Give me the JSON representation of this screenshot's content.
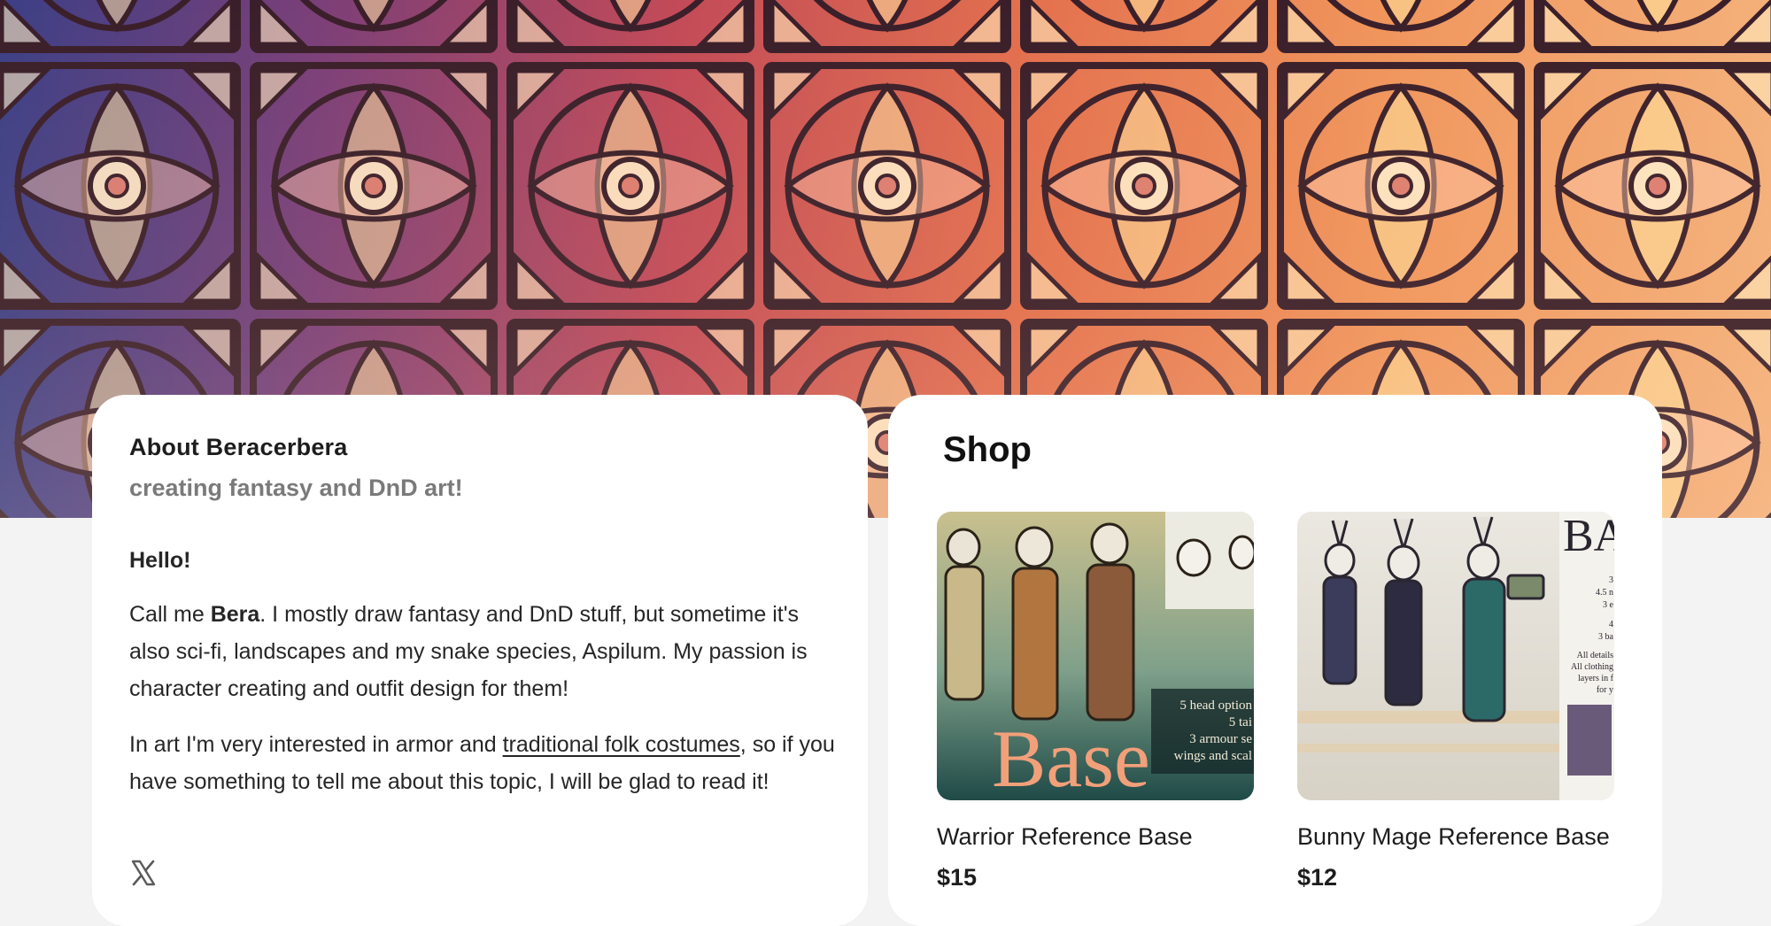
{
  "about": {
    "title": "About Beracerbera",
    "tagline": "creating fantasy and DnD art!",
    "greeting": "Hello!",
    "p1_before": "Call me ",
    "p1_name": "Bera",
    "p1_after": ". I mostly draw  fantasy and DnD stuff, but sometime it's also sci-fi, landscapes and my snake species, Aspilum. My passion is character creating and outfit design for them!",
    "p2_before": "In art I'm very interested in armor and ",
    "p2_link": "traditional folk costumes",
    "p2_after": ", so if you have something to tell me about this topic, I will be glad to read it!",
    "social_icon": "x-twitter-icon"
  },
  "shop": {
    "title": "Shop",
    "products": [
      {
        "name": "Warrior Reference Base",
        "price": "$15",
        "thumb_word": "Base",
        "thumb_lines": [
          "5 head option",
          "5 tai",
          "3 armour se",
          "wings and scal"
        ]
      },
      {
        "name": "Bunny Mage Reference Base",
        "price": "$12",
        "thumb_word": "BA",
        "thumb_lines": [
          "3",
          "4.5 n",
          "3 e",
          "4",
          "3 ba",
          "All details",
          "All clothing",
          "layers in f",
          "for y"
        ]
      }
    ]
  },
  "colors": {
    "page_bg": "#f3f3f3",
    "card_bg": "#ffffff",
    "accent_text": "#1d1d1d",
    "muted_text": "#7a7a7a",
    "banner_left": "#3c3f86",
    "banner_right": "#f4b07a"
  }
}
